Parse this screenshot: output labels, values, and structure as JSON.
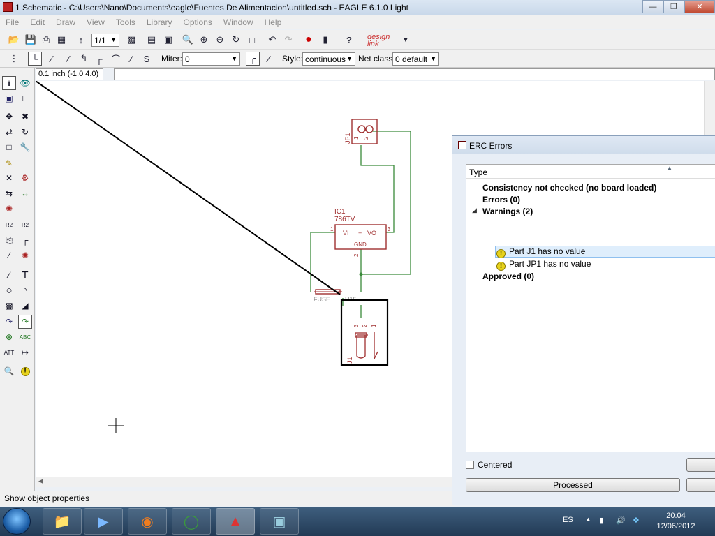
{
  "window": {
    "title": "1 Schematic - C:\\Users\\Nano\\Documents\\eagle\\Fuentes De Alimentacion\\untitled.sch - EAGLE 6.1.0 Light"
  },
  "menu": [
    "File",
    "Edit",
    "Draw",
    "View",
    "Tools",
    "Library",
    "Options",
    "Window",
    "Help"
  ],
  "toolbar": {
    "sheet": "1/1",
    "designlink": "design link"
  },
  "toolbar2": {
    "miter_label": "Miter:",
    "miter_value": "0",
    "style_label": "Style:",
    "style_value": "continuous",
    "netclass_label": "Net class:",
    "netclass_value": "0 default"
  },
  "coords": "0.1 inch (-1.0 4.0)",
  "schematic": {
    "jp1": "JP1",
    "jp1_pin1": "1",
    "jp1_pin2": "2",
    "ic1_name": "IC1",
    "ic1_value": "786TV",
    "ic1_vi": "VI",
    "ic1_vo": "VO",
    "ic1_gnd": "GND",
    "ic1_plus": "+",
    "ic1_pin1": "1",
    "ic1_pin2": "2",
    "ic1_pin3": "3",
    "fuse": "FUSE",
    "fuse_suffix": "H15",
    "j1": "J1",
    "j1_pin3": "3",
    "j1_pin2": "2",
    "j1_pin1": "1"
  },
  "status": "Show object properties",
  "erc": {
    "title": "ERC Errors",
    "column": "Type",
    "rows": [
      "Consistency not checked (no board loaded)",
      "Errors (0)",
      "Warnings (2)",
      "Part J1 has no value",
      "Part JP1 has no value",
      "Approved (0)"
    ],
    "centered": "Centered",
    "processed": "Processed"
  },
  "taskbar": {
    "lang": "ES",
    "time": "20:04",
    "date": "12/06/2012"
  },
  "colors": {
    "part": "#a03030",
    "wire": "#3a8a3a",
    "selection": "#000000"
  }
}
